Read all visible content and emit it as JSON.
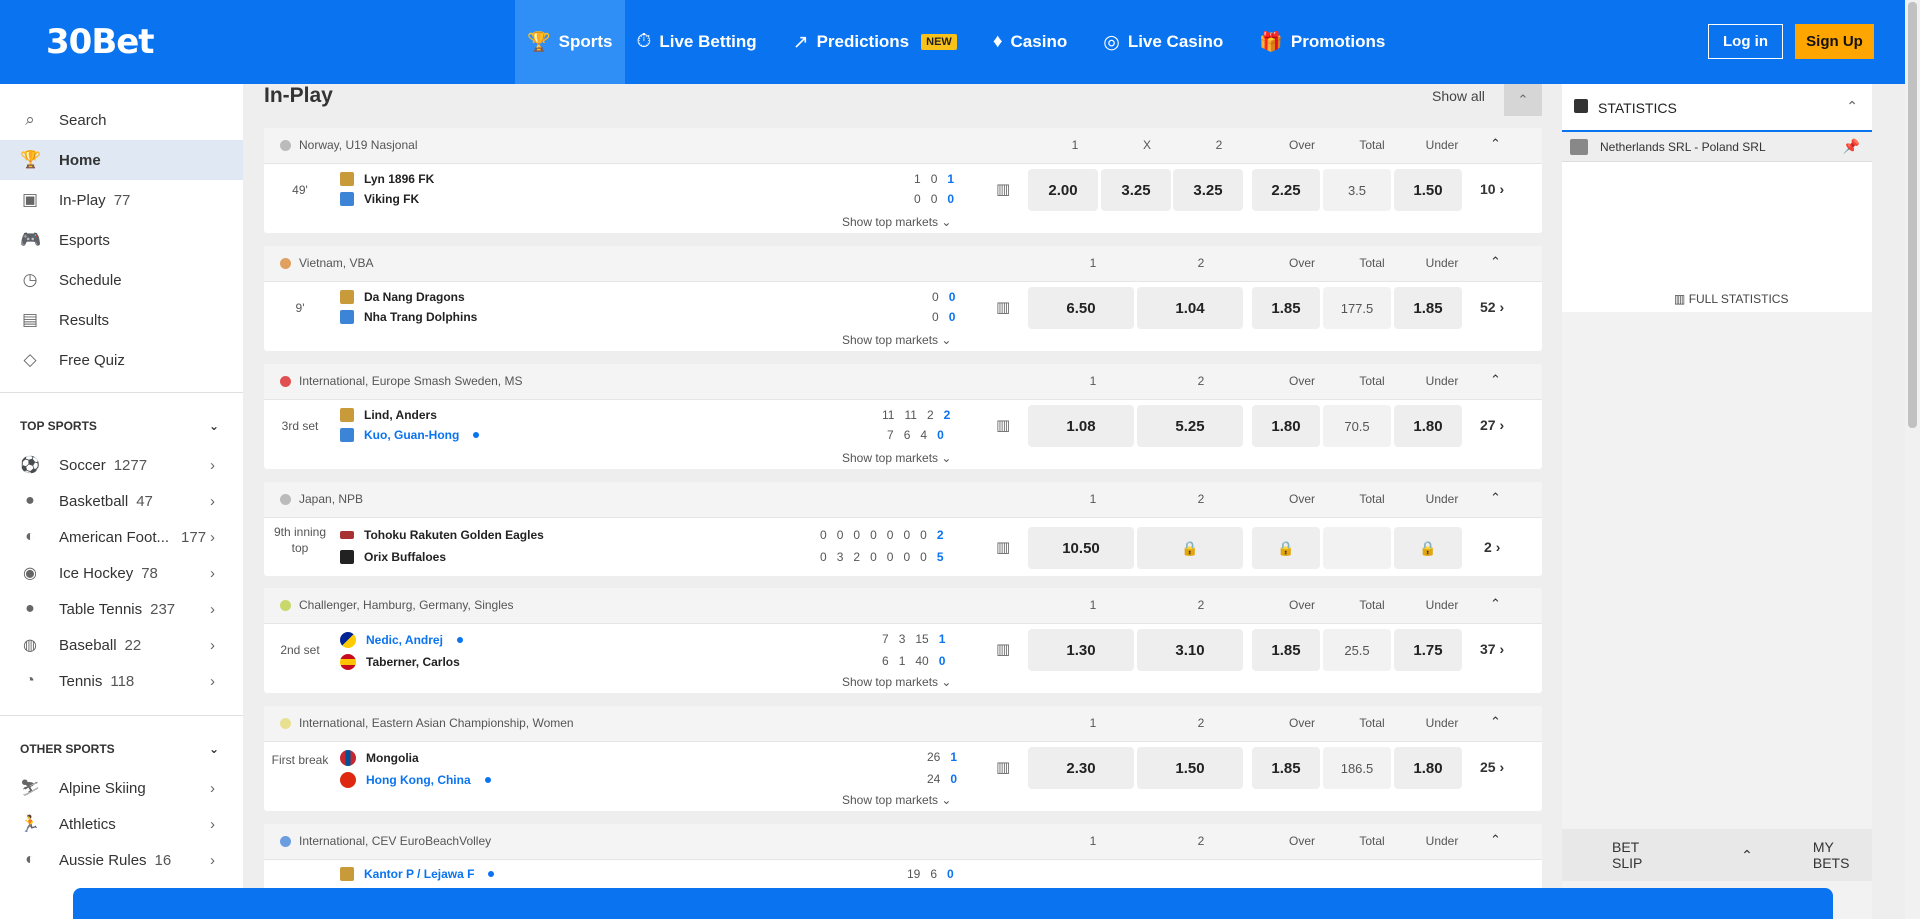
{
  "header": {
    "logo": "30Bet",
    "nav": [
      {
        "label": "Sports",
        "icon": "🏆"
      },
      {
        "label": "Live Betting",
        "icon": "⏱"
      },
      {
        "label": "Predictions",
        "icon": "↗",
        "badge": "NEW"
      },
      {
        "label": "Casino",
        "icon": "♦"
      },
      {
        "label": "Live Casino",
        "icon": "◎"
      },
      {
        "label": "Promotions",
        "icon": "🎁"
      }
    ],
    "login": "Log in",
    "signup": "Sign Up"
  },
  "sidebar": {
    "items": [
      {
        "label": "Search",
        "icon": "⌕"
      },
      {
        "label": "Home",
        "icon": "🏆"
      },
      {
        "label": "In-Play",
        "count": "77",
        "icon": "▣"
      },
      {
        "label": "Esports",
        "icon": "🎮"
      },
      {
        "label": "Schedule",
        "icon": "◷"
      },
      {
        "label": "Results",
        "icon": "▤"
      },
      {
        "label": "Free Quiz",
        "icon": "◇"
      }
    ],
    "top_sports_title": "TOP SPORTS",
    "top_sports": [
      {
        "label": "Soccer",
        "count": "1277",
        "icon": "⚽"
      },
      {
        "label": "Basketball",
        "count": "47",
        "icon": "●"
      },
      {
        "label": "American Foot...",
        "count": "177",
        "icon": "◐"
      },
      {
        "label": "Ice Hockey",
        "count": "78",
        "icon": "◉"
      },
      {
        "label": "Table Tennis",
        "count": "237",
        "icon": "●"
      },
      {
        "label": "Baseball",
        "count": "22",
        "icon": "◍"
      },
      {
        "label": "Tennis",
        "count": "118",
        "icon": "◔"
      }
    ],
    "other_sports_title": "OTHER SPORTS",
    "other_sports": [
      {
        "label": "Alpine Skiing",
        "count": "",
        "icon": "⛷"
      },
      {
        "label": "Athletics",
        "count": "",
        "icon": "🏃"
      },
      {
        "label": "Aussie Rules",
        "count": "16",
        "icon": "◐"
      }
    ]
  },
  "main": {
    "title": "In-Play",
    "show_all": "Show all",
    "show_top": "Show top markets",
    "events": [
      {
        "league": "Norway, U19 Nasjonal",
        "league_color": "#bbbbbb",
        "cols": [
          "1",
          "X",
          "2",
          "Over",
          "Total",
          "Under"
        ],
        "time": "49'",
        "team1": "Lyn 1896 FK",
        "team2": "Viking FK",
        "s1": [
          "1",
          "0",
          "1"
        ],
        "s2": [
          "0",
          "0",
          "0"
        ],
        "odds": [
          "2.00",
          "3.25",
          "3.25"
        ],
        "over": "2.25",
        "total": "3.5",
        "under": "1.50",
        "more": "10"
      },
      {
        "league": "Vietnam, VBA",
        "league_color": "#e0a060",
        "cols": [
          "1",
          "2",
          "Over",
          "Total",
          "Under"
        ],
        "time": "9'",
        "team1": "Da Nang Dragons",
        "team2": "Nha Trang Dolphins",
        "s1": [
          "0",
          "0"
        ],
        "s2": [
          "0",
          "0"
        ],
        "odds": [
          "6.50",
          "1.04"
        ],
        "over": "1.85",
        "total": "177.5",
        "under": "1.85",
        "more": "52"
      },
      {
        "league": "International, Europe Smash Sweden, MS",
        "league_color": "#e05050",
        "cols": [
          "1",
          "2",
          "Over",
          "Total",
          "Under"
        ],
        "time": "3rd set",
        "team1": "Lind, Anders",
        "team2": "Kuo, Guan-Hong",
        "s1": [
          "11",
          "11",
          "2",
          "2"
        ],
        "s2": [
          "7",
          "6",
          "4",
          "0"
        ],
        "odds": [
          "1.08",
          "5.25"
        ],
        "over": "1.80",
        "total": "70.5",
        "under": "1.80",
        "more": "27"
      },
      {
        "league": "Japan, NPB",
        "league_color": "#bbbbbb",
        "cols": [
          "1",
          "2",
          "Over",
          "Total",
          "Under"
        ],
        "time": "9th inning top",
        "team1": "Tohoku Rakuten Golden Eagles",
        "team2": "Orix Buffaloes",
        "s1": [
          "0",
          "0",
          "0",
          "0",
          "0",
          "0",
          "0",
          "2"
        ],
        "s2": [
          "0",
          "3",
          "2",
          "0",
          "0",
          "0",
          "0",
          "5"
        ],
        "odds": [
          "10.50",
          ""
        ],
        "over": "",
        "total": "",
        "under": "",
        "more": "2"
      },
      {
        "league": "Challenger, Hamburg, Germany, Singles",
        "league_color": "#c8d86a",
        "cols": [
          "1",
          "2",
          "Over",
          "Total",
          "Under"
        ],
        "time": "2nd set",
        "team1": "Nedic, Andrej",
        "team2": "Taberner, Carlos",
        "s1": [
          "7",
          "3",
          "15",
          "1"
        ],
        "s2": [
          "6",
          "1",
          "40",
          "0"
        ],
        "odds": [
          "1.30",
          "3.10"
        ],
        "over": "1.85",
        "total": "25.5",
        "under": "1.75",
        "more": "37"
      },
      {
        "league": "International, Eastern Asian Championship, Women",
        "league_color": "#e8e090",
        "cols": [
          "1",
          "2",
          "Over",
          "Total",
          "Under"
        ],
        "time": "First break",
        "team1": "Mongolia",
        "team2": "Hong Kong, China",
        "s1": [
          "26",
          "1"
        ],
        "s2": [
          "24",
          "0"
        ],
        "odds": [
          "2.30",
          "1.50"
        ],
        "over": "1.85",
        "total": "186.5",
        "under": "1.80",
        "more": "25"
      },
      {
        "league": "International, CEV EuroBeachVolley",
        "league_color": "#6a9ee0",
        "cols": [
          "1",
          "2",
          "Over",
          "Total",
          "Under"
        ],
        "team1": "Kantor P / Lejawa F",
        "s1": [
          "19",
          "6",
          "0"
        ]
      }
    ]
  },
  "stats": {
    "title": "STATISTICS",
    "match": "Netherlands SRL - Poland SRL",
    "full": "FULL STATISTICS",
    "betslip": "BET SLIP",
    "mybets": "MY BETS"
  }
}
